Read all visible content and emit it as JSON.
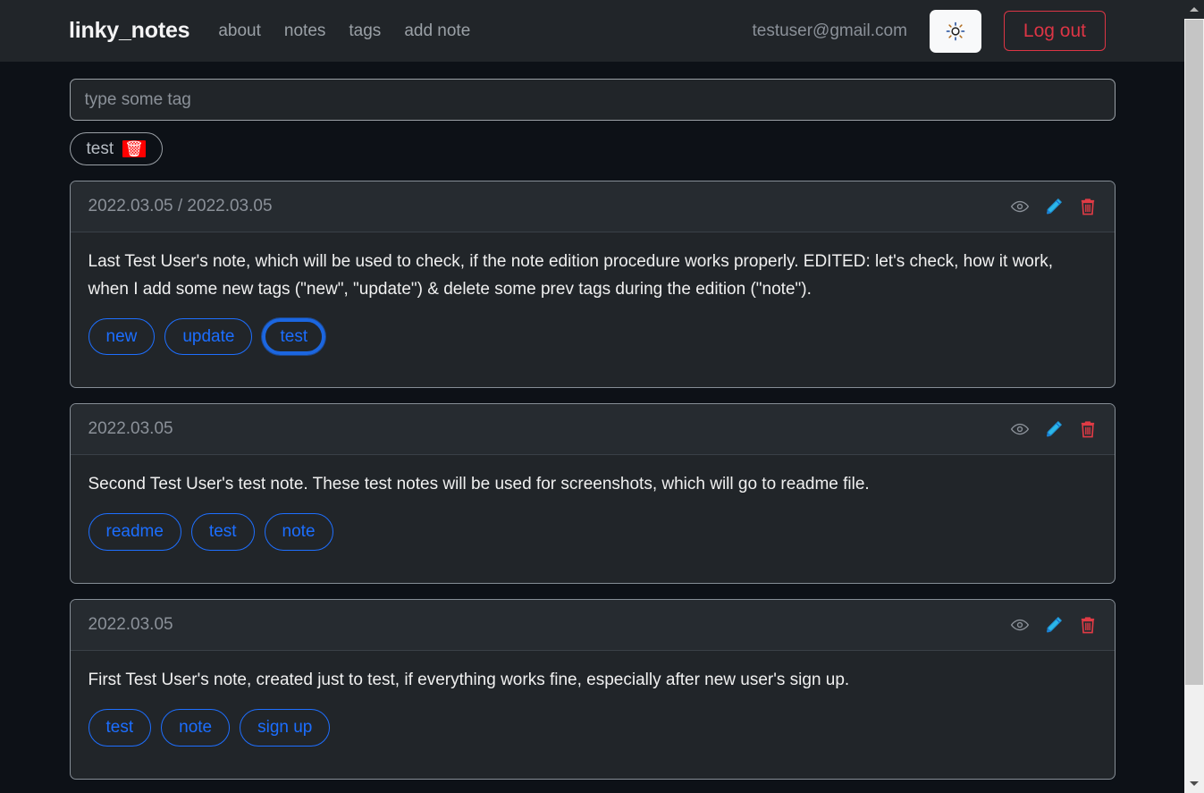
{
  "colors": {
    "page_bg": "#0d1117",
    "nav_bg": "#212529",
    "card_bg": "#212529",
    "card_head_bg": "#262b30",
    "tag_blue": "#1c6eff",
    "danger_red": "#dc3545",
    "trash_red": "#ff0000",
    "muted_text": "#8b9199",
    "body_text": "#f0f0f0"
  },
  "navbar": {
    "brand": "linky_notes",
    "links": [
      {
        "label": "about"
      },
      {
        "label": "notes"
      },
      {
        "label": "tags"
      },
      {
        "label": "add note"
      }
    ],
    "user_email": "testuser@gmail.com",
    "theme_toggle_icon": "sun-icon",
    "logout_label": "Log out"
  },
  "search": {
    "placeholder": "type some tag",
    "value": ""
  },
  "active_filters": [
    {
      "label": "test",
      "delete_icon": "trash-icon"
    }
  ],
  "note_actions": [
    {
      "name": "view-icon",
      "title": "view"
    },
    {
      "name": "edit-icon",
      "title": "edit"
    },
    {
      "name": "delete-icon",
      "title": "delete"
    }
  ],
  "notes": [
    {
      "date": "2022.03.05 / 2022.03.05",
      "text": "Last Test User's note, which will be used to check, if the note edition procedure works properly. EDITED: let's check, how it work, when I add some new tags (\"new\", \"update\") & delete some prev tags during the edition (\"note\").",
      "tags": [
        {
          "label": "new",
          "active": false
        },
        {
          "label": "update",
          "active": false
        },
        {
          "label": "test",
          "active": true
        }
      ]
    },
    {
      "date": "2022.03.05",
      "text": "Second Test User's test note. These test notes will be used for screenshots, which will go to readme file.",
      "tags": [
        {
          "label": "readme",
          "active": false
        },
        {
          "label": "test",
          "active": false
        },
        {
          "label": "note",
          "active": false
        }
      ]
    },
    {
      "date": "2022.03.05",
      "text": "First Test User's note, created just to test, if everything works fine, especially after new user's sign up.",
      "tags": [
        {
          "label": "test",
          "active": false
        },
        {
          "label": "note",
          "active": false
        },
        {
          "label": "sign up",
          "active": false
        }
      ]
    }
  ],
  "scrollbar": {
    "up_arrow": "scroll-up-arrow",
    "down_arrow": "scroll-down-arrow",
    "thumb": "scrollbar-thumb"
  }
}
